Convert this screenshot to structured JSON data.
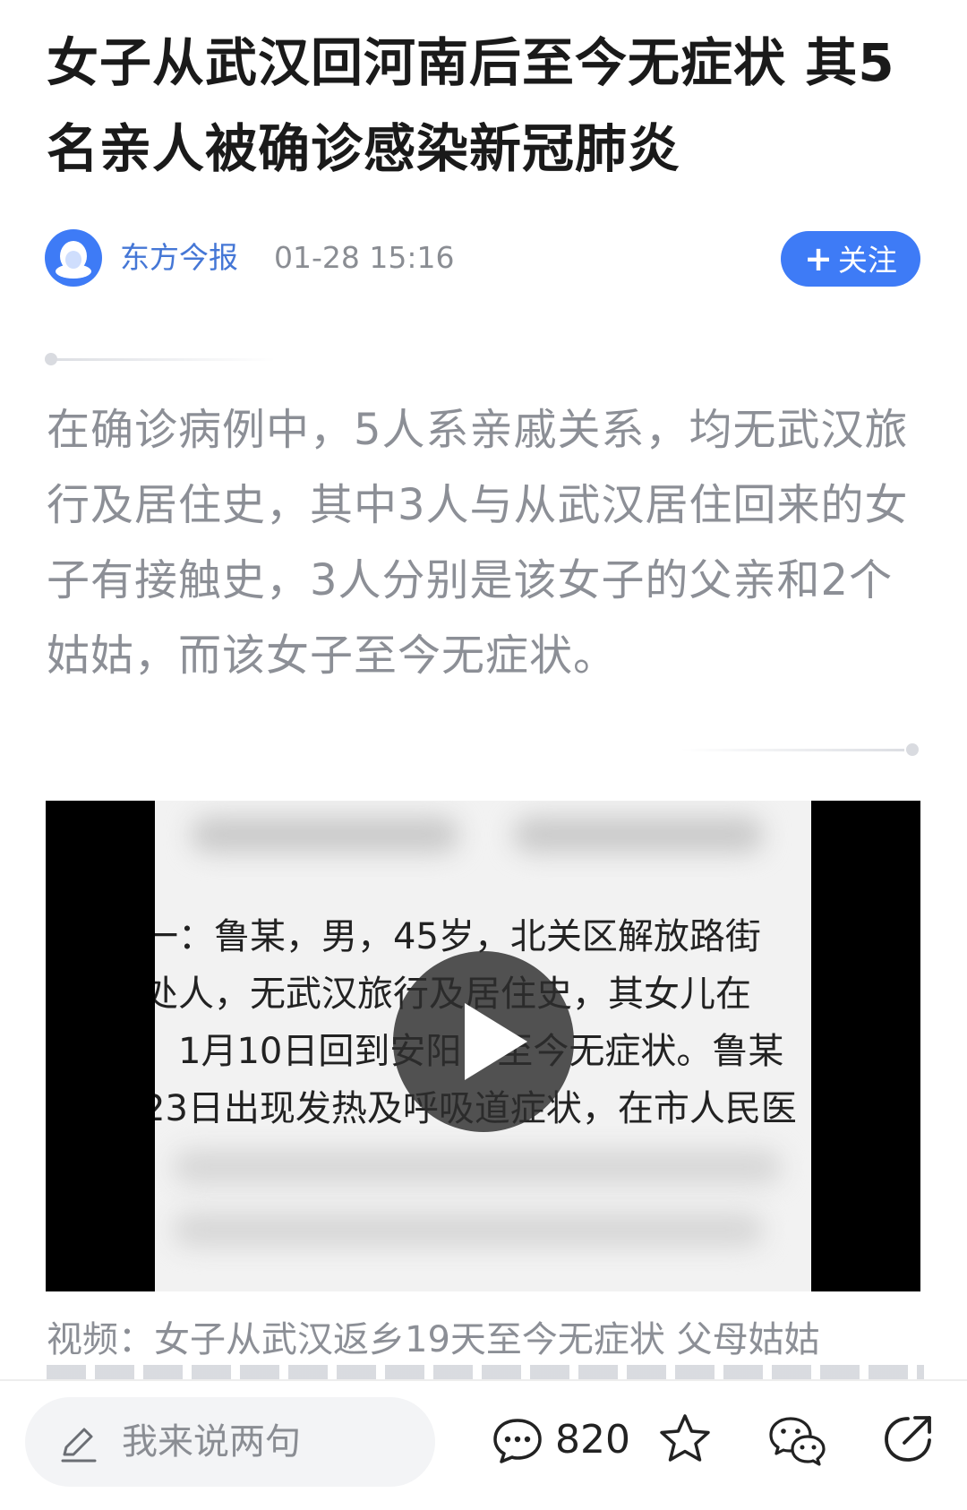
{
  "article": {
    "title": "女子从武汉回河南后至今无症状 其5名亲人被确诊感染新冠肺炎",
    "source": {
      "name": "东方今报",
      "time": "01-28 15:16",
      "follow_label": "关注",
      "avatar_icon": "penguin-avatar-icon"
    },
    "summary": "在确诊病例中，5人系亲戚关系，均无武汉旅行及居住史，其中3人与从武汉居住回来的女子有接触史，3人分别是该女子的父亲和2个姑姑，而该女子至今无症状。",
    "video": {
      "frame_lines": [
        "一：鲁某，男，45岁，北关区解放路街",
        "处人，无武汉旅行及居住史，其女儿在",
        "，1月10日回到安阳，至今无症状。鲁某",
        "23日出现发热及呼吸道症状，在市人民医"
      ],
      "play_icon": "play-icon"
    },
    "caption": "视频：女子从武汉返乡19天至今无症状 父母姑姑"
  },
  "bottom_bar": {
    "comment_placeholder": "我来说两句",
    "comment_count": "820",
    "icons": [
      "edit-icon",
      "comment-icon",
      "star-icon",
      "wechat-icon",
      "share-icon"
    ]
  },
  "colors": {
    "accent": "#3e7bf6",
    "source_name": "#4577d6",
    "summary_text": "#8c8f96"
  }
}
